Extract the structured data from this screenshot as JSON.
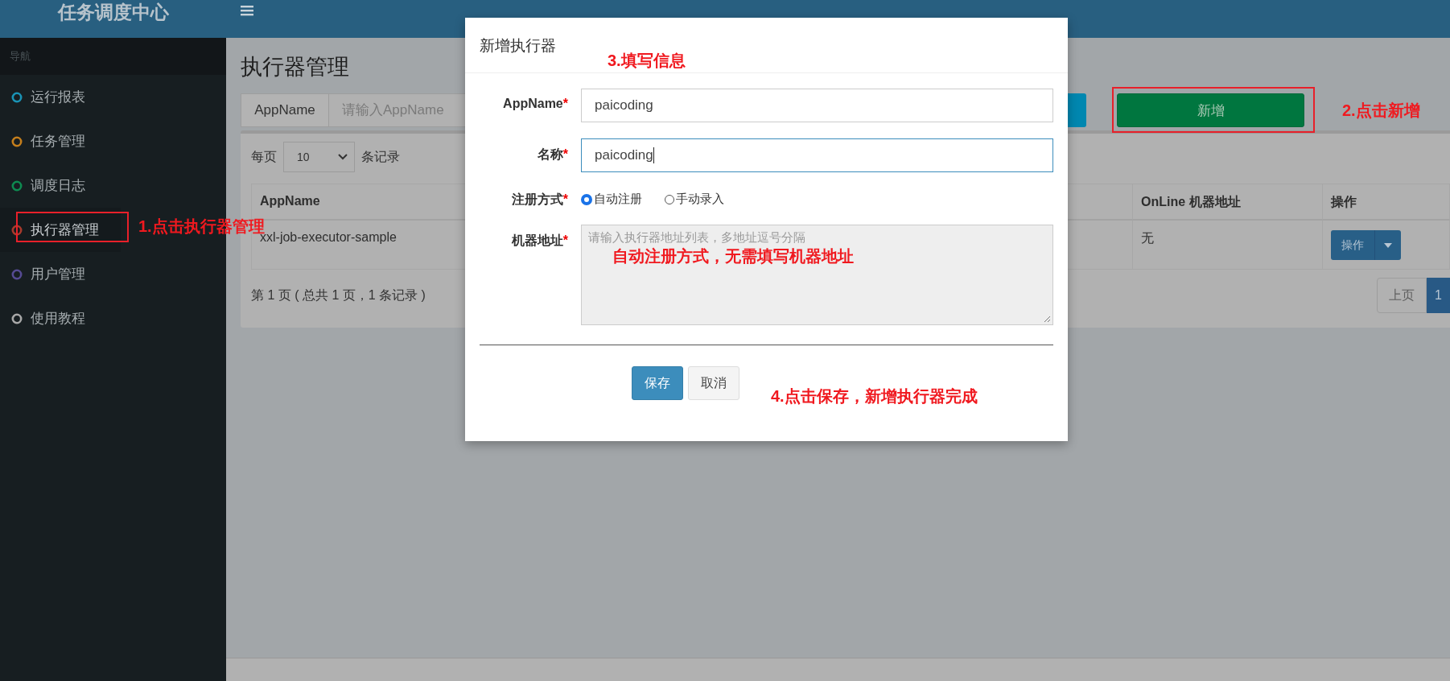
{
  "header": {
    "logo": "任务调度中心"
  },
  "sidebar": {
    "section": "导航",
    "items": [
      {
        "label": "运行报表",
        "color": "#1a93b5",
        "selected": false
      },
      {
        "label": "任务管理",
        "color": "#c47e1c",
        "selected": false
      },
      {
        "label": "调度日志",
        "color": "#0e8a50",
        "selected": false
      },
      {
        "label": "执行器管理",
        "color": "#a83a2c",
        "selected": true
      },
      {
        "label": "用户管理",
        "color": "#554a92",
        "selected": false
      },
      {
        "label": "使用教程",
        "color": "#a8a8a8",
        "selected": false
      }
    ]
  },
  "page": {
    "title": "执行器管理",
    "search": {
      "label": "AppName",
      "placeholder": "请输入AppName"
    },
    "add_button": "新增",
    "page_size": {
      "before": "每页",
      "value": "10",
      "after": "条记录"
    },
    "table": {
      "columns": [
        "AppName",
        "OnLine 机器地址",
        "操作"
      ],
      "rows": [
        {
          "app_name": "xxl-job-executor-sample",
          "online_address": "无",
          "action": "操作"
        }
      ]
    },
    "summary": "第 1 页 ( 总共 1 页，1 条记录 )",
    "pagination": [
      {
        "label": "上页",
        "selected": false
      },
      {
        "label": "1",
        "selected": true
      }
    ]
  },
  "modal": {
    "title": "新增执行器",
    "fields": [
      {
        "kind": "input",
        "label": "AppName",
        "required_mark": "*",
        "value": "paicoding",
        "focused": false
      },
      {
        "kind": "input",
        "label": "名称",
        "required_mark": "*",
        "value": "paicoding",
        "focused": true
      },
      {
        "kind": "radio",
        "label": "注册方式",
        "required_mark": "*",
        "options": [
          {
            "label": "自动注册",
            "selected": true
          },
          {
            "label": "手动录入",
            "selected": false
          }
        ]
      },
      {
        "kind": "textarea",
        "label": "机器地址",
        "required_mark": "*",
        "placeholder": "请输入执行器地址列表，多地址逗号分隔",
        "disabled": true
      }
    ],
    "buttons": [
      {
        "label": "保存",
        "kind": "primary"
      },
      {
        "label": "取消",
        "kind": "default"
      }
    ]
  },
  "annotations": [
    "1.点击执行器管理",
    "2.点击新增",
    "3.填写信息",
    "自动注册方式，无需填写机器地址",
    "4.点击保存，新增执行器完成"
  ]
}
